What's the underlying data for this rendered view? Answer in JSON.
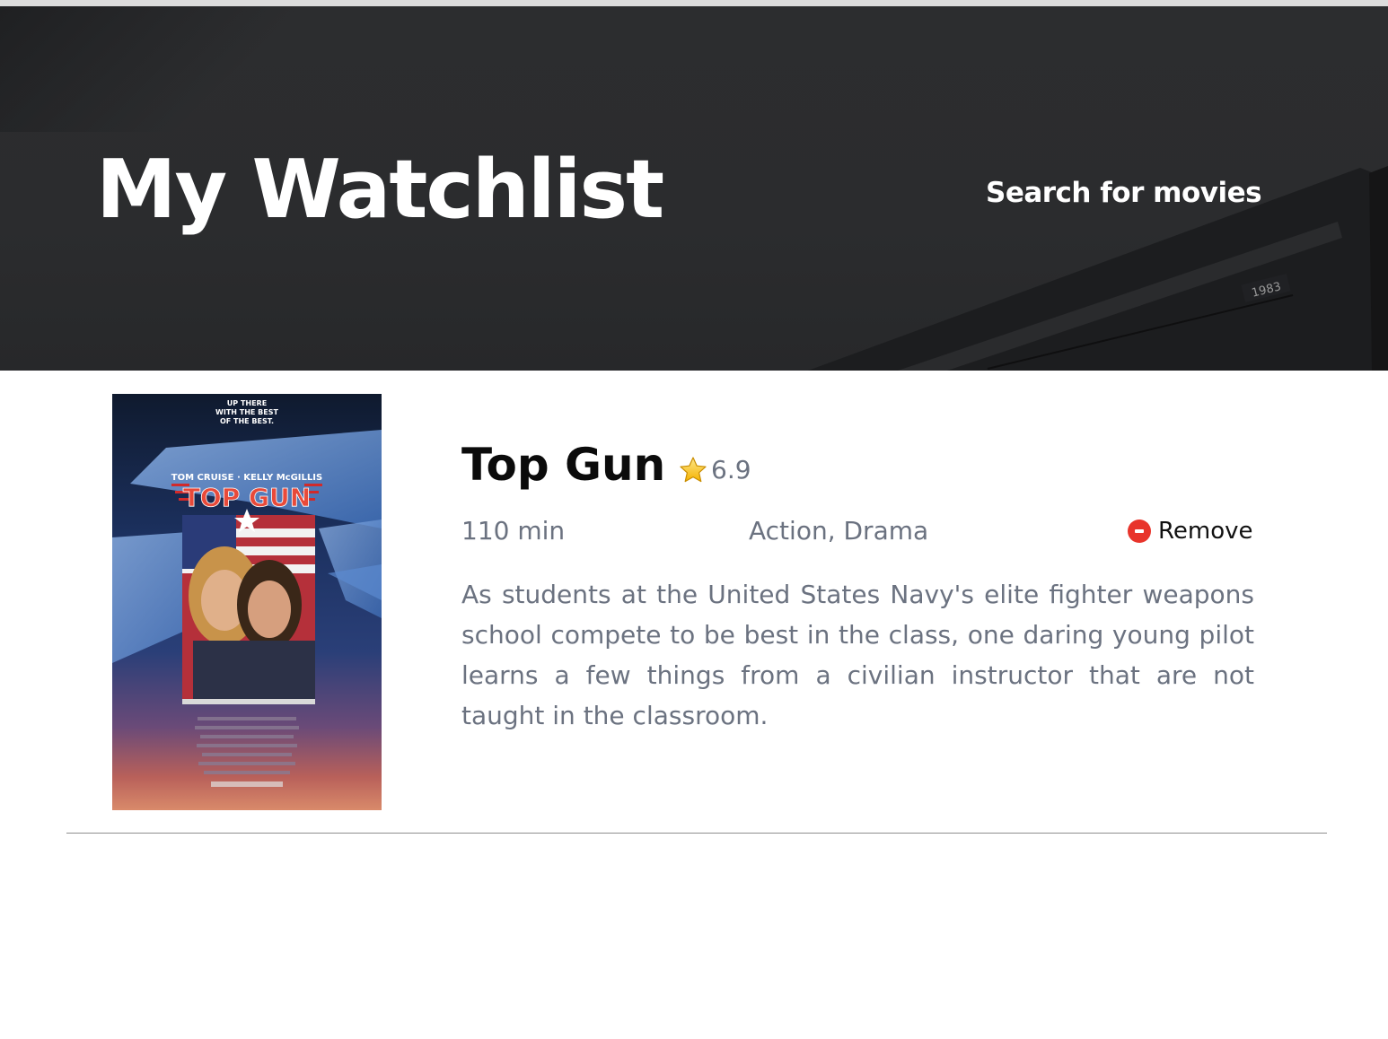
{
  "header": {
    "title": "My Watchlist",
    "search_link": "Search for movies",
    "frame_label": "1983"
  },
  "watchlist": [
    {
      "title": "Top Gun",
      "rating": "6.9",
      "runtime": "110 min",
      "genres": "Action, Drama",
      "remove_label": "Remove",
      "overview": "As students at the United States Navy's elite fighter weapons school compete to be best in the class, one daring young pilot learns a few things from a civilian instructor that are not taught in the classroom.",
      "poster": {
        "tagline": [
          "UP THERE",
          "WITH THE BEST",
          "OF THE BEST."
        ],
        "cast": "TOM CRUISE · KELLY McGILLIS",
        "title": "TOP GUN"
      }
    }
  ],
  "icons": {
    "rating": "star-icon",
    "remove": "minus-circle-icon"
  },
  "colors": {
    "hero_background": "#2b2c2e",
    "remove_icon": "#e8342b",
    "muted_text": "#6b7280",
    "star": "#f5c518"
  }
}
